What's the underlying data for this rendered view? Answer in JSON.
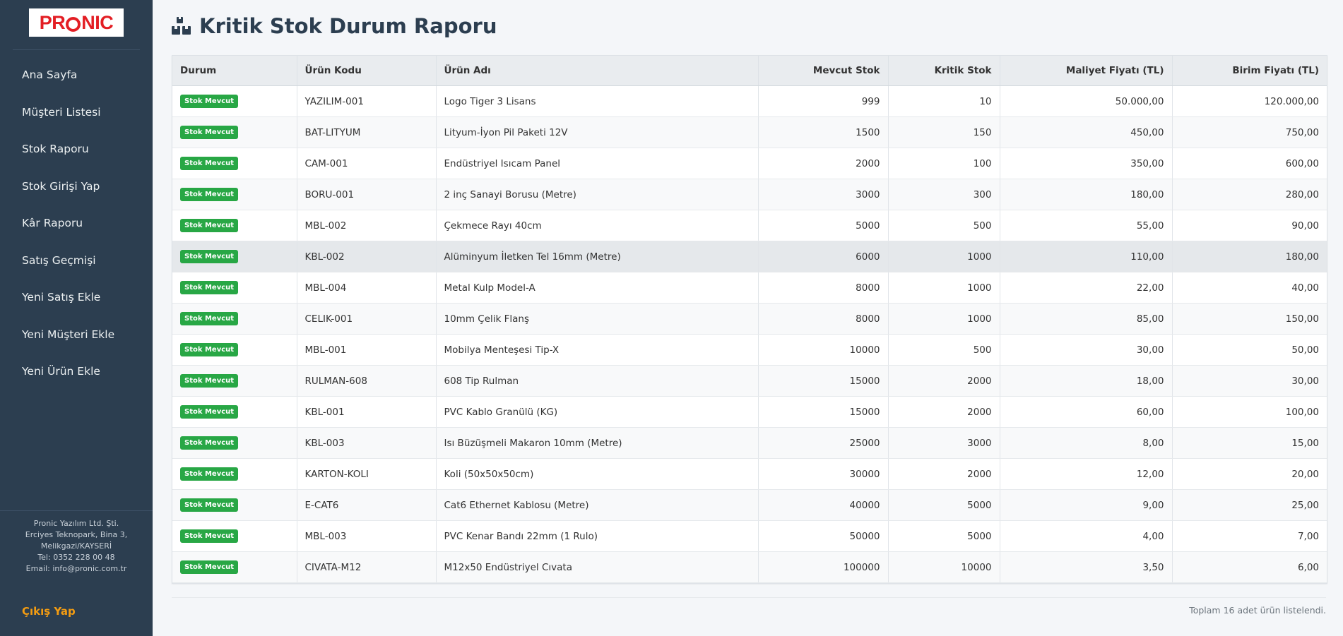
{
  "sidebar": {
    "logo_text": "PRONIC",
    "items": [
      {
        "label": "Ana Sayfa"
      },
      {
        "label": "Müşteri Listesi"
      },
      {
        "label": "Stok Raporu"
      },
      {
        "label": "Stok Girişi Yap"
      },
      {
        "label": "Kâr Raporu"
      },
      {
        "label": "Satış Geçmişi"
      },
      {
        "label": "Yeni Satış Ekle"
      },
      {
        "label": "Yeni Müşteri Ekle"
      },
      {
        "label": "Yeni Ürün Ekle"
      }
    ],
    "company": {
      "name": "Pronic Yazılım Ltd. Şti.",
      "address1": "Erciyes Teknopark, Bina 3,",
      "address2": "Melikgazi/KAYSERİ",
      "phone": "Tel: 0352 228 00 48",
      "email": "Email: info@pronic.com.tr"
    },
    "logout_label": "Çıkış Yap"
  },
  "page": {
    "title": "Kritik Stok Durum Raporu",
    "title_icon": "boxes-icon"
  },
  "table": {
    "headers": [
      "Durum",
      "Ürün Kodu",
      "Ürün Adı",
      "Mevcut Stok",
      "Kritik Stok",
      "Maliyet Fiyatı (TL)",
      "Birim Fiyatı (TL)"
    ],
    "rows": [
      {
        "status": "Stok Mevcut",
        "code": "YAZILIM-001",
        "name": "Logo Tiger 3 Lisans",
        "stock": "999",
        "critical": "10",
        "cost": "50.000,00",
        "price": "120.000,00"
      },
      {
        "status": "Stok Mevcut",
        "code": "BAT-LITYUM",
        "name": "Lityum-İyon Pil Paketi 12V",
        "stock": "1500",
        "critical": "150",
        "cost": "450,00",
        "price": "750,00"
      },
      {
        "status": "Stok Mevcut",
        "code": "CAM-001",
        "name": "Endüstriyel Isıcam Panel",
        "stock": "2000",
        "critical": "100",
        "cost": "350,00",
        "price": "600,00"
      },
      {
        "status": "Stok Mevcut",
        "code": "BORU-001",
        "name": "2 inç Sanayi Borusu (Metre)",
        "stock": "3000",
        "critical": "300",
        "cost": "180,00",
        "price": "280,00"
      },
      {
        "status": "Stok Mevcut",
        "code": "MBL-002",
        "name": "Çekmece Rayı 40cm",
        "stock": "5000",
        "critical": "500",
        "cost": "55,00",
        "price": "90,00"
      },
      {
        "status": "Stok Mevcut",
        "code": "KBL-002",
        "name": "Alüminyum İletken Tel 16mm (Metre)",
        "stock": "6000",
        "critical": "1000",
        "cost": "110,00",
        "price": "180,00"
      },
      {
        "status": "Stok Mevcut",
        "code": "MBL-004",
        "name": "Metal Kulp Model-A",
        "stock": "8000",
        "critical": "1000",
        "cost": "22,00",
        "price": "40,00"
      },
      {
        "status": "Stok Mevcut",
        "code": "CELIK-001",
        "name": "10mm Çelik Flanş",
        "stock": "8000",
        "critical": "1000",
        "cost": "85,00",
        "price": "150,00"
      },
      {
        "status": "Stok Mevcut",
        "code": "MBL-001",
        "name": "Mobilya Menteşesi Tip-X",
        "stock": "10000",
        "critical": "500",
        "cost": "30,00",
        "price": "50,00"
      },
      {
        "status": "Stok Mevcut",
        "code": "RULMAN-608",
        "name": "608 Tip Rulman",
        "stock": "15000",
        "critical": "2000",
        "cost": "18,00",
        "price": "30,00"
      },
      {
        "status": "Stok Mevcut",
        "code": "KBL-001",
        "name": "PVC Kablo Granülü (KG)",
        "stock": "15000",
        "critical": "2000",
        "cost": "60,00",
        "price": "100,00"
      },
      {
        "status": "Stok Mevcut",
        "code": "KBL-003",
        "name": "Isı Büzüşmeli Makaron 10mm (Metre)",
        "stock": "25000",
        "critical": "3000",
        "cost": "8,00",
        "price": "15,00"
      },
      {
        "status": "Stok Mevcut",
        "code": "KARTON-KOLI",
        "name": "Koli (50x50x50cm)",
        "stock": "30000",
        "critical": "2000",
        "cost": "12,00",
        "price": "20,00"
      },
      {
        "status": "Stok Mevcut",
        "code": "E-CAT6",
        "name": "Cat6 Ethernet Kablosu (Metre)",
        "stock": "40000",
        "critical": "5000",
        "cost": "9,00",
        "price": "25,00"
      },
      {
        "status": "Stok Mevcut",
        "code": "MBL-003",
        "name": "PVC Kenar Bandı 22mm (1 Rulo)",
        "stock": "50000",
        "critical": "5000",
        "cost": "4,00",
        "price": "7,00"
      },
      {
        "status": "Stok Mevcut",
        "code": "CIVATA-M12",
        "name": "M12x50 Endüstriyel Cıvata",
        "stock": "100000",
        "critical": "10000",
        "cost": "3,50",
        "price": "6,00"
      }
    ],
    "highlighted_row_code": "KBL-002"
  },
  "footer": {
    "total_text": "Toplam 16 adet ürün listelendi."
  },
  "colors": {
    "sidebar_bg": "#2c3e50",
    "accent_logout": "#f39c12",
    "badge_green": "#28a745",
    "brand_red": "#e31e24"
  }
}
